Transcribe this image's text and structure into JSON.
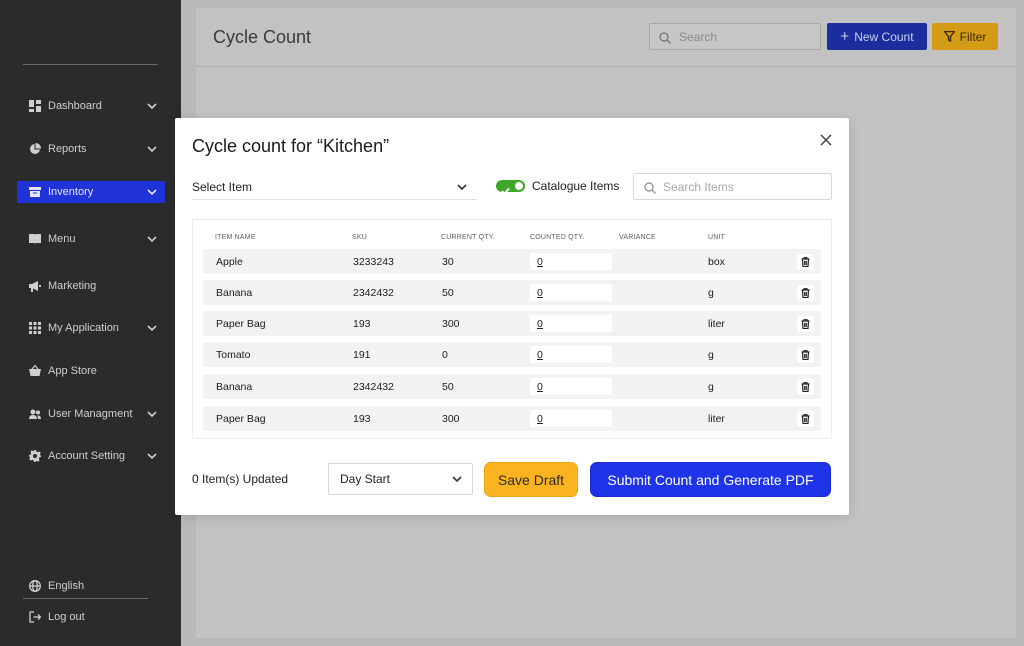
{
  "sidebar": {
    "items": [
      {
        "label": "Dashboard",
        "icon": "dashboard-icon",
        "has_chevron": true
      },
      {
        "label": "Reports",
        "icon": "pie-chart-icon",
        "has_chevron": true
      },
      {
        "label": "Inventory",
        "icon": "archive-icon",
        "has_chevron": true,
        "active": true
      },
      {
        "label": "Menu",
        "icon": "book-icon",
        "has_chevron": true
      },
      {
        "label": "Marketing",
        "icon": "megaphone-icon",
        "has_chevron": false
      },
      {
        "label": "My Application",
        "icon": "grid-icon",
        "has_chevron": true
      },
      {
        "label": "App Store",
        "icon": "basket-icon",
        "has_chevron": false
      },
      {
        "label": "User Managment",
        "icon": "users-icon",
        "has_chevron": true
      },
      {
        "label": "Account Setting",
        "icon": "gear-icon",
        "has_chevron": true
      }
    ],
    "language": "English",
    "logout": "Log out",
    "active_color": "#1f33d6"
  },
  "main": {
    "title": "Cycle Count",
    "search_placeholder": "Search",
    "new_count_label": "New Count",
    "filter_label": "Filter"
  },
  "modal": {
    "title": "Cycle count for “Kitchen”",
    "select_item_label": "Select Item",
    "catalogue_toggle_label": "Catalogue Items",
    "catalogue_toggle_on": true,
    "search_items_placeholder": "Search Items",
    "columns": [
      "ITEM NAME",
      "SKU",
      "CURRENT QTY.",
      "COUNTED QTY.",
      "VARIANCE",
      "UNIT"
    ],
    "rows": [
      {
        "name": "Apple",
        "sku": "3233243",
        "current_qty": "30",
        "counted_qty": "0",
        "variance": "",
        "unit": "box"
      },
      {
        "name": "Banana",
        "sku": "2342432",
        "current_qty": "50",
        "counted_qty": "0",
        "variance": "",
        "unit": "g"
      },
      {
        "name": "Paper Bag",
        "sku": "193",
        "current_qty": "300",
        "counted_qty": "0",
        "variance": "",
        "unit": "liter"
      },
      {
        "name": "Tomato",
        "sku": "191",
        "current_qty": "0",
        "counted_qty": "0",
        "variance": "",
        "unit": "g"
      },
      {
        "name": "Banana",
        "sku": "2342432",
        "current_qty": "50",
        "counted_qty": "0",
        "variance": "",
        "unit": "g"
      },
      {
        "name": "Paper Bag",
        "sku": "193",
        "current_qty": "300",
        "counted_qty": "0",
        "variance": "",
        "unit": "liter"
      }
    ],
    "updated_text": "0 Item(s) Updated",
    "day_select_value": "Day Start",
    "save_draft_label": "Save Draft",
    "submit_label": "Submit Count and Generate PDF",
    "colors": {
      "save_draft": "#fbb420",
      "submit": "#1f33e8",
      "toggle_on": "#3fa62a"
    }
  }
}
